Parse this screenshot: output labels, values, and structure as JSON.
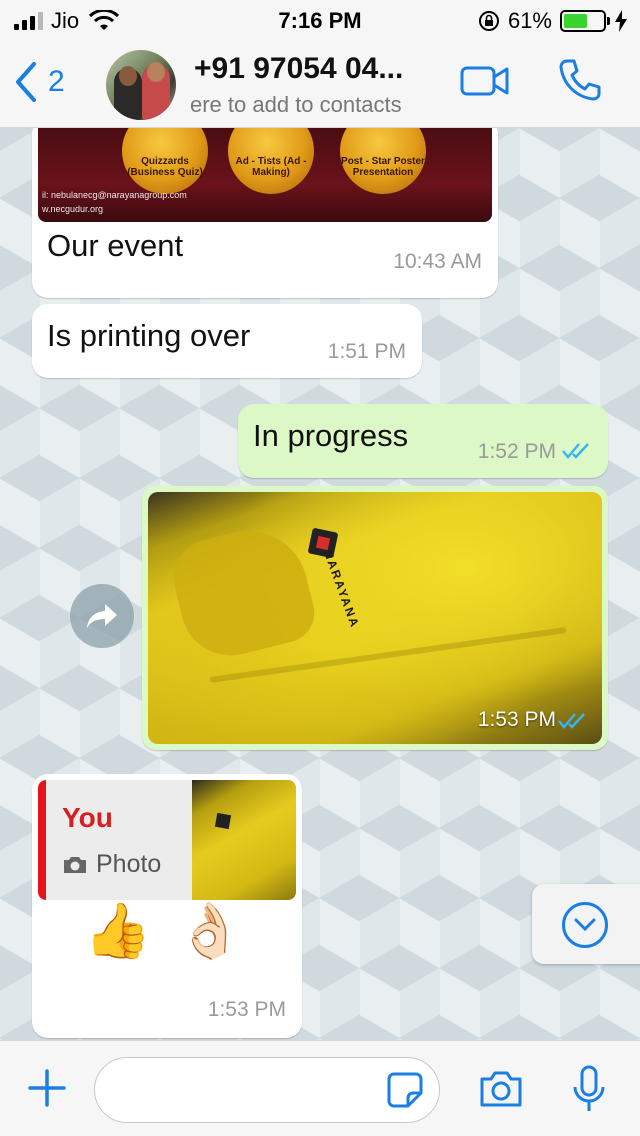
{
  "status_bar": {
    "carrier": "Jio",
    "time": "7:16 PM",
    "battery_percent": "61%",
    "battery_level": 0.61
  },
  "header": {
    "back_count": "2",
    "contact_name": "+91 97054 04...",
    "contact_subtitle": "ere to add to contacts"
  },
  "messages": [
    {
      "direction": "incoming",
      "image_text": {
        "medals": [
          "Quizzards (Business Quiz)",
          "Ad - Tists (Ad - Making)",
          "Post - Star Poster Presentation"
        ],
        "email": "il: nebulanecg@narayanagroup.com",
        "site": "w.necgudur.org"
      },
      "text": "Our event",
      "time": "10:43 AM"
    },
    {
      "direction": "incoming",
      "text": "Is printing over",
      "time": "1:51 PM"
    },
    {
      "direction": "outgoing",
      "text": "In progress",
      "time": "1:52 PM",
      "status": "read"
    },
    {
      "direction": "outgoing",
      "type": "photo",
      "brand_text": "NARAYANA",
      "time": "1:53 PM",
      "status": "read"
    },
    {
      "direction": "incoming",
      "reply_to": {
        "author": "You",
        "type_label": "Photo"
      },
      "emoji": [
        "👍",
        "👌🏻"
      ],
      "time": "1:53 PM"
    }
  ],
  "input": {
    "placeholder": ""
  },
  "colors": {
    "accent": "#1a7ee3",
    "incoming_bubble": "#ffffff",
    "outgoing_bubble": "#dcf8c6",
    "read_ticks": "#34b7f1",
    "reply_author": "#d81e1e"
  },
  "icons": {
    "back": "chevron-left-icon",
    "video_call": "video-camera-icon",
    "voice_call": "phone-icon",
    "forward": "forward-arrow-icon",
    "scroll_down": "chevron-down-circle-icon",
    "attach": "plus-icon",
    "sticker": "sticker-icon",
    "camera": "camera-icon",
    "microphone": "microphone-icon"
  }
}
